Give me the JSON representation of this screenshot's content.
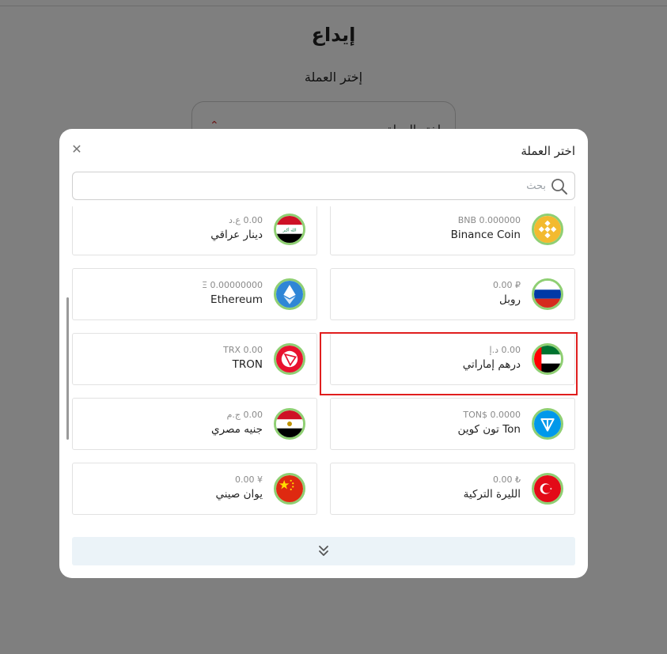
{
  "background": {
    "title": "إيداع",
    "subtitle": "إختر العملة",
    "select_label": "إختر العملة"
  },
  "modal": {
    "title": "اختر العملة",
    "search_placeholder": "بحث",
    "cards": [
      {
        "amount": "0.00 ع.د",
        "name": "دينار عراقي",
        "icon": "iraq-flag-icon"
      },
      {
        "amount": "BNB 0.000000",
        "name": "Binance Coin",
        "icon": "binance-coin-icon"
      },
      {
        "amount": "Ξ 0.00000000",
        "name": "Ethereum",
        "icon": "ethereum-icon"
      },
      {
        "amount": "₽ 0.00",
        "name": "روبل",
        "icon": "russia-flag-icon"
      },
      {
        "amount": "TRX 0.00",
        "name": "TRON",
        "icon": "tron-icon"
      },
      {
        "amount": "0.00 د.إ",
        "name": "درهم إماراتي",
        "icon": "uae-flag-icon"
      },
      {
        "amount": "0.00 ج.م",
        "name": "جنيه مصري",
        "icon": "egypt-flag-icon"
      },
      {
        "amount": "TON$ 0.0000",
        "name": "Ton تون كوين",
        "icon": "ton-coin-icon"
      },
      {
        "amount": "¥ 0.00",
        "name": "يوان صيني",
        "icon": "china-flag-icon"
      },
      {
        "amount": "₺ 0.00",
        "name": "الليرة التركية",
        "icon": "turkey-flag-icon"
      }
    ]
  },
  "colors": {
    "accent_red": "#e01e1e",
    "flag_ring": "#8fcf73",
    "more_bar_bg": "#ebf3f8"
  }
}
